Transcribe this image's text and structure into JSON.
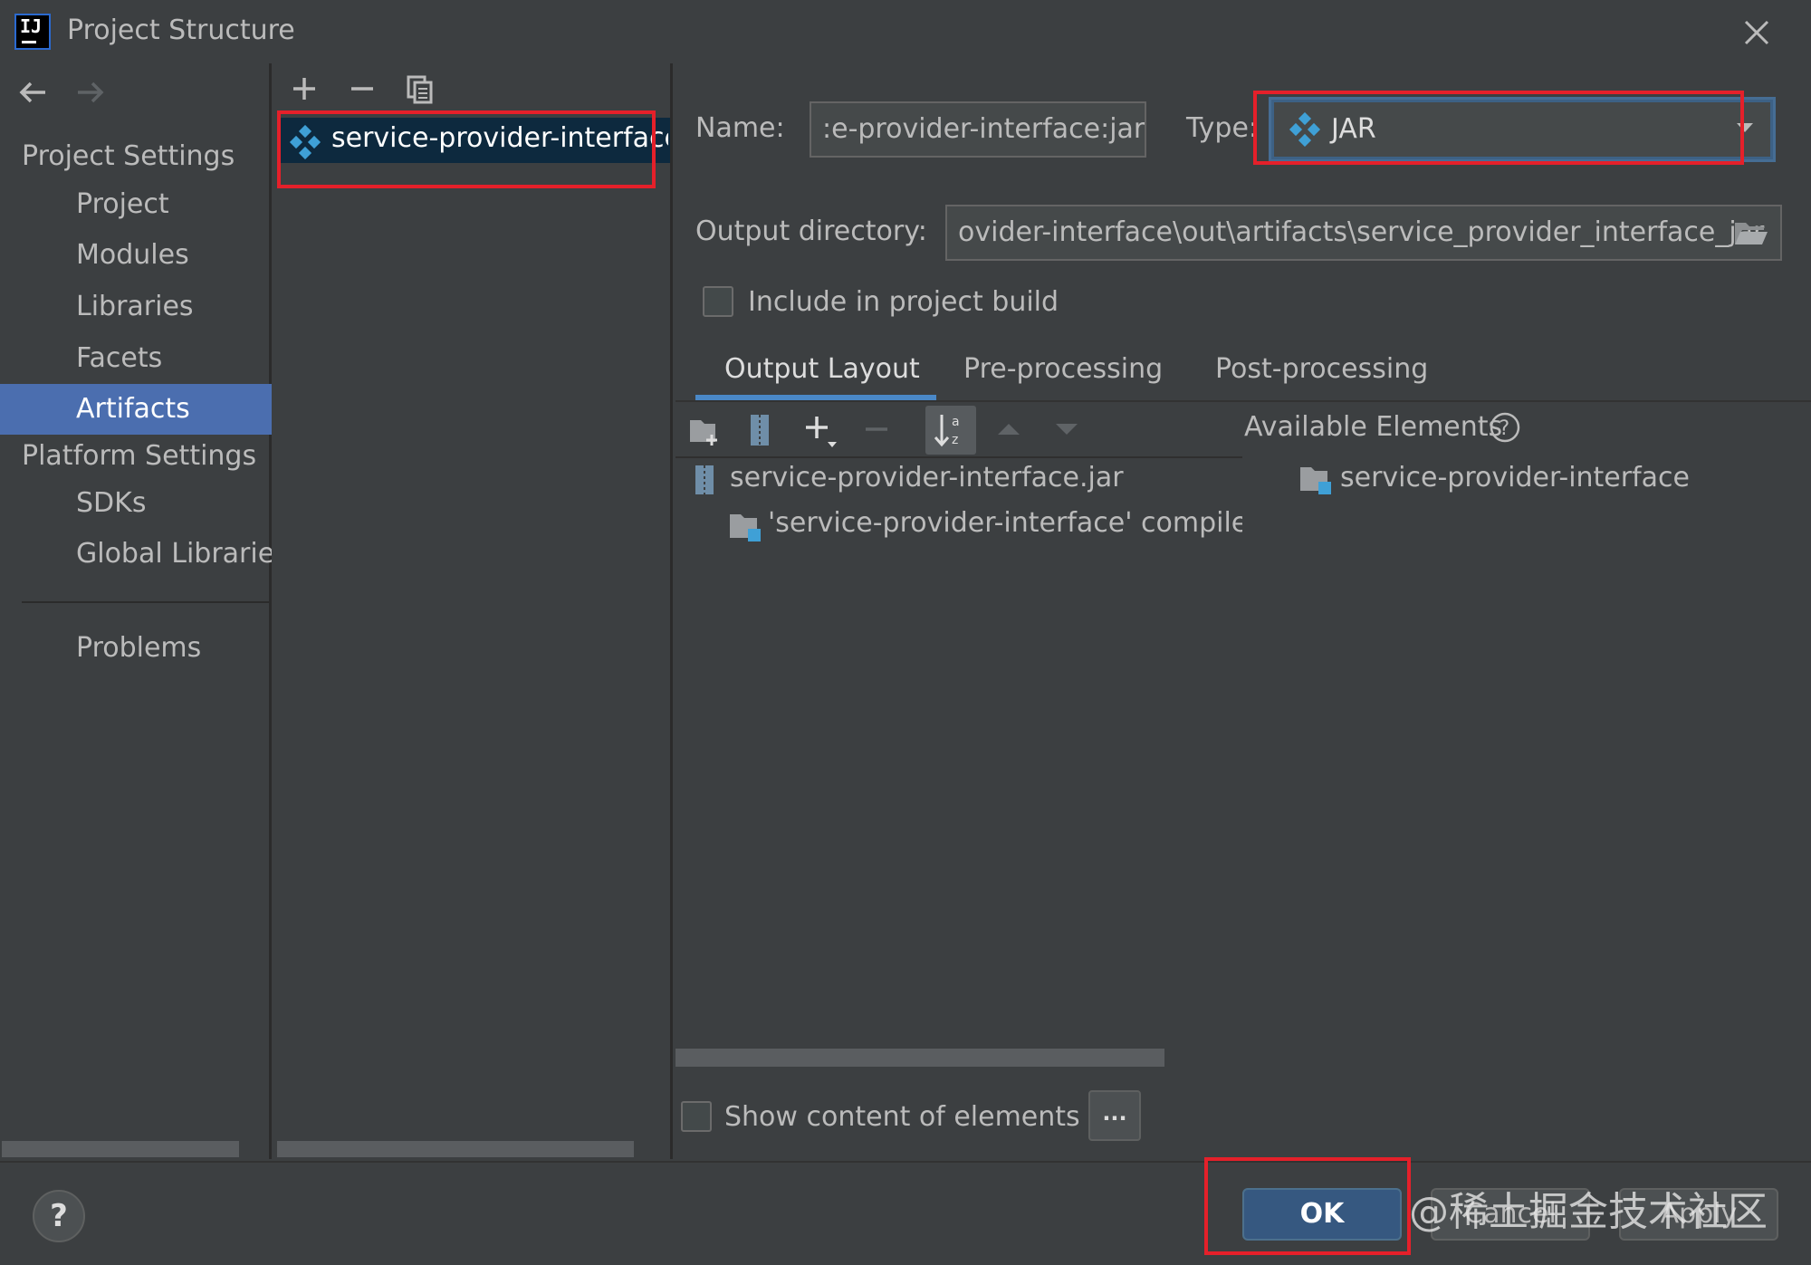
{
  "window": {
    "title": "Project Structure",
    "logo_text": "IJ"
  },
  "nav": {
    "project_settings_label": "Project Settings",
    "project_settings_items": [
      "Project",
      "Modules",
      "Libraries",
      "Facets",
      "Artifacts"
    ],
    "selected": "Artifacts",
    "platform_settings_label": "Platform Settings",
    "platform_settings_items": [
      "SDKs",
      "Global Libraries"
    ],
    "problems_label": "Problems"
  },
  "artifacts_list": {
    "items": [
      "service-provider-interface:jar"
    ]
  },
  "form": {
    "name_label": "Name:",
    "name_value": ":e-provider-interface:jar",
    "type_label": "Type:",
    "type_value": "JAR",
    "output_dir_label": "Output directory:",
    "output_dir_value": "ovider-interface\\out\\artifacts\\service_provider_interface_jar",
    "include_label": "Include in project build",
    "include_checked": false
  },
  "tabs": [
    "Output Layout",
    "Pre-processing",
    "Post-processing"
  ],
  "active_tab": "Output Layout",
  "output_layout": {
    "tree": [
      {
        "label": "service-provider-interface.jar",
        "icon": "jar-archive-icon"
      },
      {
        "label": "'service-provider-interface' compile o",
        "icon": "module-folder-icon"
      }
    ],
    "available_elements_label": "Available Elements",
    "available_elements": [
      {
        "label": "service-provider-interface",
        "icon": "module-folder-icon"
      }
    ],
    "show_content_label": "Show content of elements",
    "show_content_checked": false,
    "more_button": "..."
  },
  "footer": {
    "help": "?",
    "ok": "OK",
    "cancel": "Cancel",
    "apply": "Apply"
  },
  "watermark": "@稀土掘金技术社区",
  "colors": {
    "background": "#3c3f41",
    "selection": "#4b6eaf",
    "highlight_box": "#e5202a",
    "ok_button": "#365880"
  }
}
